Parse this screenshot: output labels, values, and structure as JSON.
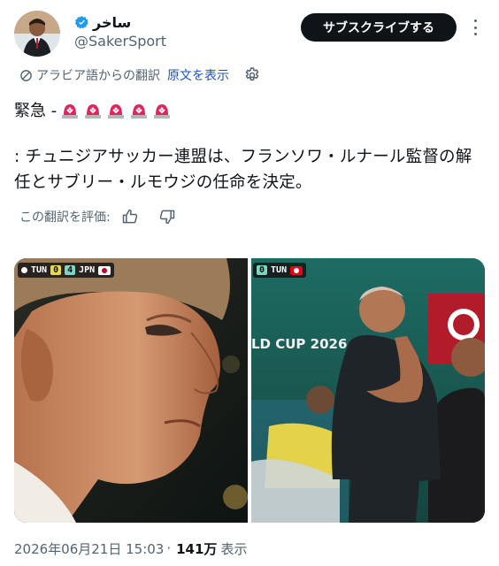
{
  "header": {
    "display_name": "ساخر",
    "handle": "@SakerSport",
    "subscribe_label": "サブスクライブする"
  },
  "translation": {
    "translated_from": "アラビア語からの翻訳",
    "show_original": "原文を表示",
    "rate_prompt": "この翻訳を評価:"
  },
  "tweet": {
    "line1": "緊急 -",
    "body": ": チュニジアサッカー連盟は、フランソワ・ルナール監督の解任とサブリー・ルモウジの任命を決定。"
  },
  "media": {
    "photo1": {
      "team_home": "TUN",
      "score_home": "0",
      "score_away": "4",
      "team_away": "JPN"
    },
    "photo2": {
      "score": "0",
      "team": "TUN",
      "backdrop_text": "LD CUP 2026"
    }
  },
  "footer": {
    "timestamp": "2026年06月21日 15:03",
    "separator": "·",
    "views_count": "141万",
    "views_label": "表示"
  },
  "colors": {
    "accent_blue": "#1d9bf0",
    "link_blue": "#1d4ed8",
    "siren_red": "#e0245e",
    "text_primary": "#0f1419",
    "text_secondary": "#536471"
  }
}
